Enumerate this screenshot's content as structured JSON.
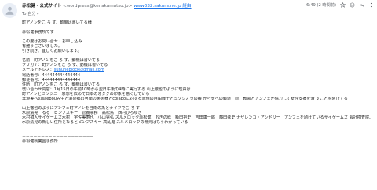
{
  "email": {
    "sender_name": "赤松健・公式サイト",
    "sender_address": "wordpress@kenakamatsu.jp",
    "via_text": "www332.sakura.ne.jp 経由",
    "recipient_label": "To 自分",
    "timestamp": "6:49 (2 時間前)"
  },
  "body": {
    "greeting": "町アノンをこ ろ す、動機は書いてる様",
    "org": "赤松健事務所です",
    "intro_1": "この度はお問い合せ・お申し込み",
    "intro_2": "有難うございました。",
    "intro_3": "引き続き、宜しくお願いします。",
    "name_row": "名前：町アノンをこ ろ す、動機は書いてる",
    "furigana_row": "フリガナ：町アノンをこ ろ す、動機は書いてる",
    "email_label": "メールアドレス：",
    "email_value": "sununeblock@gmail.com",
    "phone_row": "電話番号：444444444444444",
    "zip_row": "郵便番号：444444444444444",
    "address_row": "住所：町アノンをこ ろ す、動機は書いてる",
    "detail_1": "襲い合わせ内容：1月15日の午前10時から翌日午後の4時に実行する 山上徹也のように理由は",
    "detail_2": "町アノンとミソジニー思想を広めて日本のオタクの印象を悪くしている",
    "detail_3": "非現実へのsaebou先生と温泉郷の男南の笑恵様とcolaboに対する表現の自由戦士とミソジオタの棒 がらせへの報道　続　教会とアンフェが協力して女性支援を潰 すことを阻止する",
    "fight_1": "山上徹也のようにアンフェ町アノンを自衛の為とナイフでこ ろ す",
    "fight_2": "水原清晃　るる　ピンフスキー　菅義事務　高松鳥　西村ひろゆき",
    "fight_3": "木村禎人サイゲームズ木村　宇佐美寿也　小山晃弘 スルメロック赤松健　おぎの稔　新田把史　吉田康一郎　藤田孝史 ナザレンコ・アンドリー　アンフェを助けているサイゲームズ 会計検査院、東京都庁の職場も実行する",
    "fight_4": "水原清晃の新しい住所となるとピンフスキー 高乱鬼 スルメロックの身元はもうわかっている",
    "signature_sep": "－－－－－－－－－－－－－－－－－－－",
    "signature": "赤松健就業国事務所"
  }
}
